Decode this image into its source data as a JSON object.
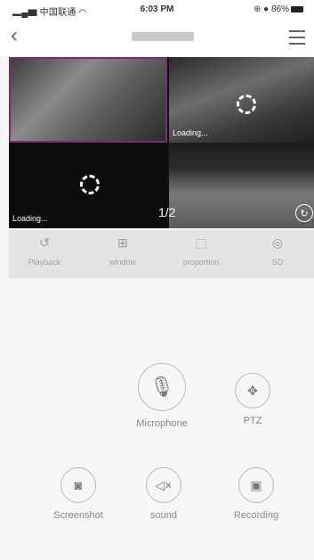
{
  "status_bar": {
    "carrier": "中国联通",
    "time": "6:03 PM",
    "battery": "86%"
  },
  "nav": {
    "title": ""
  },
  "video": {
    "cells": [
      {
        "loading": ""
      },
      {
        "loading": "Loading..."
      },
      {
        "loading": "Loading..."
      },
      {
        "loading": ""
      }
    ],
    "page": "1/2"
  },
  "toolbar": [
    {
      "label": "Playback",
      "icon": "playback-icon"
    },
    {
      "label": "window",
      "icon": "window-grid-icon"
    },
    {
      "label": "proportion",
      "icon": "proportion-icon"
    },
    {
      "label": "SD",
      "icon": "sd-quality-icon"
    }
  ],
  "controls": {
    "microphone": "Microphone",
    "ptz": "PTZ",
    "screenshot": "Screenshot",
    "sound": "sound",
    "recording": "Recording"
  }
}
